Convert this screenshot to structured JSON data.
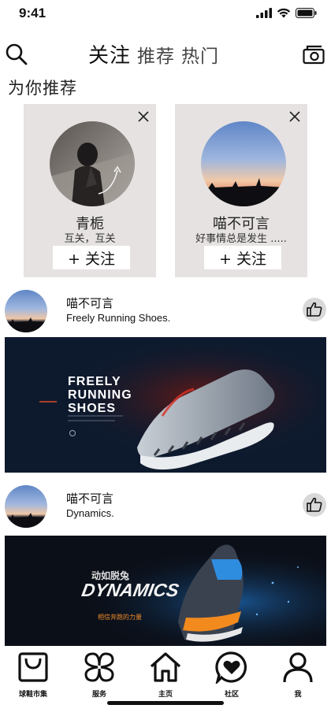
{
  "status": {
    "time": "9:41"
  },
  "nav": {
    "tabs": [
      {
        "label": "关注",
        "active": true
      },
      {
        "label": "推荐",
        "active": false
      },
      {
        "label": "热门",
        "active": false
      }
    ]
  },
  "recommend": {
    "title": "为你推荐",
    "cards": [
      {
        "name": "青栀",
        "desc": "互关，互关",
        "follow_label": "+ 关注"
      },
      {
        "name": "喵不可言",
        "desc": "好事情总是发生 .....",
        "follow_label": "+ 关注"
      }
    ]
  },
  "posts": [
    {
      "user": "喵不可言",
      "caption": "Freely Running Shoes.",
      "banner_lines": [
        "FREELY",
        "RUNNING",
        "SHOES"
      ]
    },
    {
      "user": "喵不可言",
      "caption": "Dynamics.",
      "banner_top": "动如脱兔",
      "banner_title": "DYNAMICS",
      "banner_sub": "相信奔跑的力量"
    }
  ],
  "tabbar": {
    "items": [
      {
        "label": "球鞋市集",
        "icon": "bag-icon"
      },
      {
        "label": "服务",
        "icon": "clover-icon"
      },
      {
        "label": "主页",
        "icon": "home-icon"
      },
      {
        "label": "社区",
        "icon": "heart-chat-icon"
      },
      {
        "label": "我",
        "icon": "person-icon"
      }
    ]
  },
  "colors": {
    "card_bg": "#e6e2e1",
    "like_bg": "#d9d9d9",
    "accent_orange": "#f08a2a"
  }
}
